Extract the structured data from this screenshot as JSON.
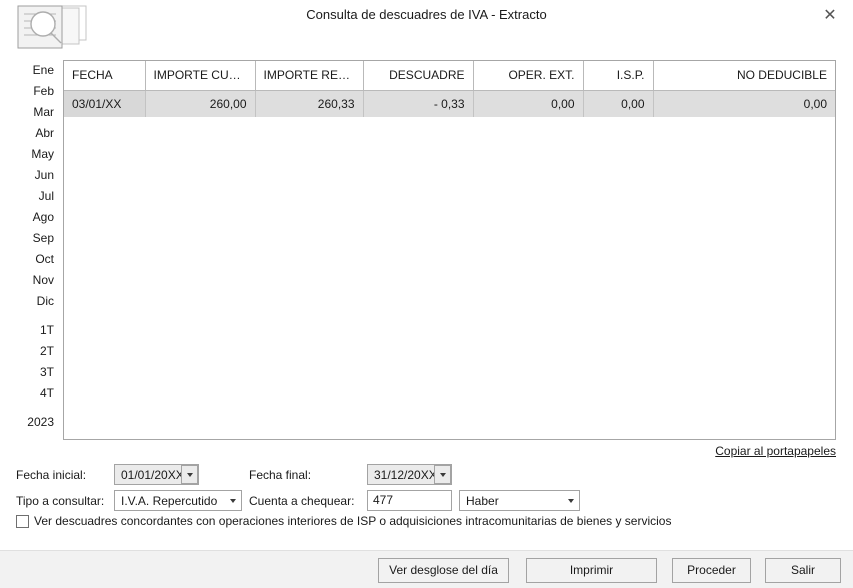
{
  "window": {
    "title": "Consulta de descuadres de IVA - Extracto",
    "close_label": "✕",
    "icon": "document-magnifier-icon"
  },
  "month_rail": {
    "items": [
      {
        "label": "Ene"
      },
      {
        "label": "Feb"
      },
      {
        "label": "Mar"
      },
      {
        "label": "Abr"
      },
      {
        "label": "May"
      },
      {
        "label": "Jun"
      },
      {
        "label": "Jul"
      },
      {
        "label": "Ago"
      },
      {
        "label": "Sep"
      },
      {
        "label": "Oct"
      },
      {
        "label": "Nov"
      },
      {
        "label": "Dic"
      },
      {
        "label": "1T"
      },
      {
        "label": "2T"
      },
      {
        "label": "3T"
      },
      {
        "label": "4T"
      },
      {
        "label": "2023"
      }
    ]
  },
  "grid": {
    "columns": [
      {
        "label": "FECHA",
        "align": "l"
      },
      {
        "label": "IMPORTE CUENT...",
        "align": "r"
      },
      {
        "label": "IMPORTE REGIST...",
        "align": "r"
      },
      {
        "label": "DESCUADRE",
        "align": "r"
      },
      {
        "label": "OPER. EXT.",
        "align": "r"
      },
      {
        "label": "I.S.P.",
        "align": "r"
      },
      {
        "label": "NO DEDUCIBLE",
        "align": "r"
      }
    ],
    "rows": [
      {
        "selected": true,
        "cells": [
          "03/01/XX",
          "260,00",
          "260,33",
          "- 0,33",
          "0,00",
          "0,00",
          "0,00"
        ]
      }
    ]
  },
  "clipboard_link": "Copiar al portapapeles",
  "form": {
    "fecha_inicial_label": "Fecha inicial:",
    "fecha_inicial_value": "01/01/20XX",
    "fecha_final_label": "Fecha final:",
    "fecha_final_value": "31/12/20XX",
    "tipo_label": "Tipo a consultar:",
    "tipo_value": "I.V.A. Repercutido",
    "cuenta_label": "Cuenta a chequear:",
    "cuenta_value": "477",
    "haber_value": "Haber"
  },
  "checkbox": {
    "label": "Ver descuadres concordantes con operaciones interiores de ISP o adquisiciones intracomunitarias de bienes y servicios",
    "checked": false
  },
  "footer": {
    "buttons": [
      {
        "label": "Ver desglose del día"
      },
      {
        "label": "Imprimir"
      },
      {
        "label": "Proceder"
      },
      {
        "label": "Salir"
      }
    ]
  },
  "colors": {
    "selected_row": "#dedede",
    "panel_border": "#a6a6a6",
    "footer_bg": "#f2f2f2"
  }
}
